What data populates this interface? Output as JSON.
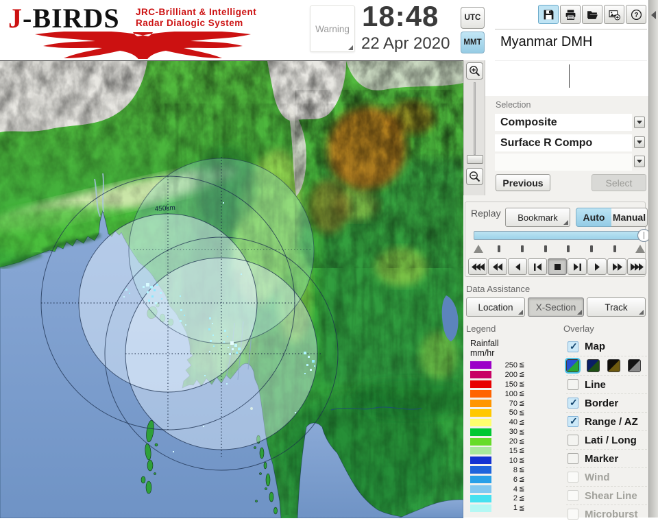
{
  "header": {
    "logo": {
      "j": "J",
      "birds": "-BIRDS",
      "tag1": "JRC-Brilliant & Intelligent",
      "tag2": "Radar  Dialogic  System"
    },
    "warning_label": "Warning",
    "clock": {
      "time": "18:48",
      "date": "22 Apr 2020"
    },
    "tz": {
      "utc": "UTC",
      "mmt": "MMT"
    },
    "toolbar_icons": [
      {
        "name": "save",
        "active": true
      },
      {
        "name": "print",
        "active": false
      },
      {
        "name": "open-folder",
        "active": false
      },
      {
        "name": "capture",
        "active": false
      },
      {
        "name": "help",
        "active": false
      }
    ]
  },
  "panel": {
    "site_title": "Myanmar DMH",
    "selection": {
      "label": "Selection",
      "combo1": "Composite",
      "combo2": "Surface R Compo",
      "combo3": ""
    },
    "previous_label": "Previous",
    "select_label": "Select",
    "replay": {
      "label": "Replay",
      "bookmark": "Bookmark",
      "auto": "Auto",
      "manual": "Manual"
    },
    "playback": [
      {
        "name": "rewind-fast",
        "icon": "rw3",
        "active": false
      },
      {
        "name": "rewind",
        "icon": "rw2",
        "active": false
      },
      {
        "name": "play-reverse",
        "icon": "rw1",
        "active": false
      },
      {
        "name": "step-back",
        "icon": "stepb",
        "active": false
      },
      {
        "name": "stop",
        "icon": "stop",
        "active": true
      },
      {
        "name": "step-forward",
        "icon": "stepf",
        "active": false
      },
      {
        "name": "play",
        "icon": "f1",
        "active": false
      },
      {
        "name": "forward",
        "icon": "f2",
        "active": false
      },
      {
        "name": "forward-fast",
        "icon": "f3",
        "active": false
      }
    ],
    "data_assistance": {
      "label": "Data Assistance",
      "buttons": [
        "Location",
        "X-Section",
        "Track"
      ]
    },
    "legend": {
      "label": "Legend",
      "unit_line1": "Rainfall",
      "unit_line2": "mm/hr",
      "suffix": "≦",
      "rows": [
        {
          "value": "250",
          "color": "#9B00C8"
        },
        {
          "value": "200",
          "color": "#C80064"
        },
        {
          "value": "150",
          "color": "#E80000"
        },
        {
          "value": "100",
          "color": "#FF6400"
        },
        {
          "value": "70",
          "color": "#FF9600"
        },
        {
          "value": "50",
          "color": "#FFC800"
        },
        {
          "value": "40",
          "color": "#FFFF6E"
        },
        {
          "value": "30",
          "color": "#00C832"
        },
        {
          "value": "20",
          "color": "#66DC28"
        },
        {
          "value": "15",
          "color": "#A8E89C"
        },
        {
          "value": "10",
          "color": "#1432D2"
        },
        {
          "value": "8",
          "color": "#1E64DC"
        },
        {
          "value": "6",
          "color": "#28A0E8"
        },
        {
          "value": "4",
          "color": "#82C8F0"
        },
        {
          "value": "2",
          "color": "#46E1F0"
        },
        {
          "value": "1",
          "color": "#B4F8F4"
        }
      ]
    },
    "overlay": {
      "label": "Overlay",
      "items": [
        {
          "label": "Map",
          "checked": true,
          "disabled": false
        },
        {
          "label": "Line",
          "checked": false,
          "disabled": false
        },
        {
          "label": "Border",
          "checked": true,
          "disabled": false
        },
        {
          "label": "Range / AZ",
          "checked": true,
          "disabled": false
        },
        {
          "label": "Lati / Long",
          "checked": false,
          "disabled": false
        },
        {
          "label": "Marker",
          "checked": false,
          "disabled": false
        },
        {
          "label": "Wind",
          "checked": false,
          "disabled": true
        },
        {
          "label": "Shear Line",
          "checked": false,
          "disabled": true
        },
        {
          "label": "Microburst",
          "checked": false,
          "disabled": true
        }
      ],
      "map_styles": [
        {
          "name": "blue-green",
          "top": "#2850D2",
          "bottom": "#28A832",
          "selected": true
        },
        {
          "name": "navy-darkgreen",
          "top": "#0A1E64",
          "bottom": "#1E5014",
          "selected": false
        },
        {
          "name": "black-olive",
          "top": "#0F0D08",
          "bottom": "#6E5A0F",
          "selected": false
        },
        {
          "name": "black-gray",
          "top": "#141414",
          "bottom": "#8C8C8C",
          "selected": false
        }
      ]
    }
  },
  "map": {
    "range_label": "450km"
  }
}
